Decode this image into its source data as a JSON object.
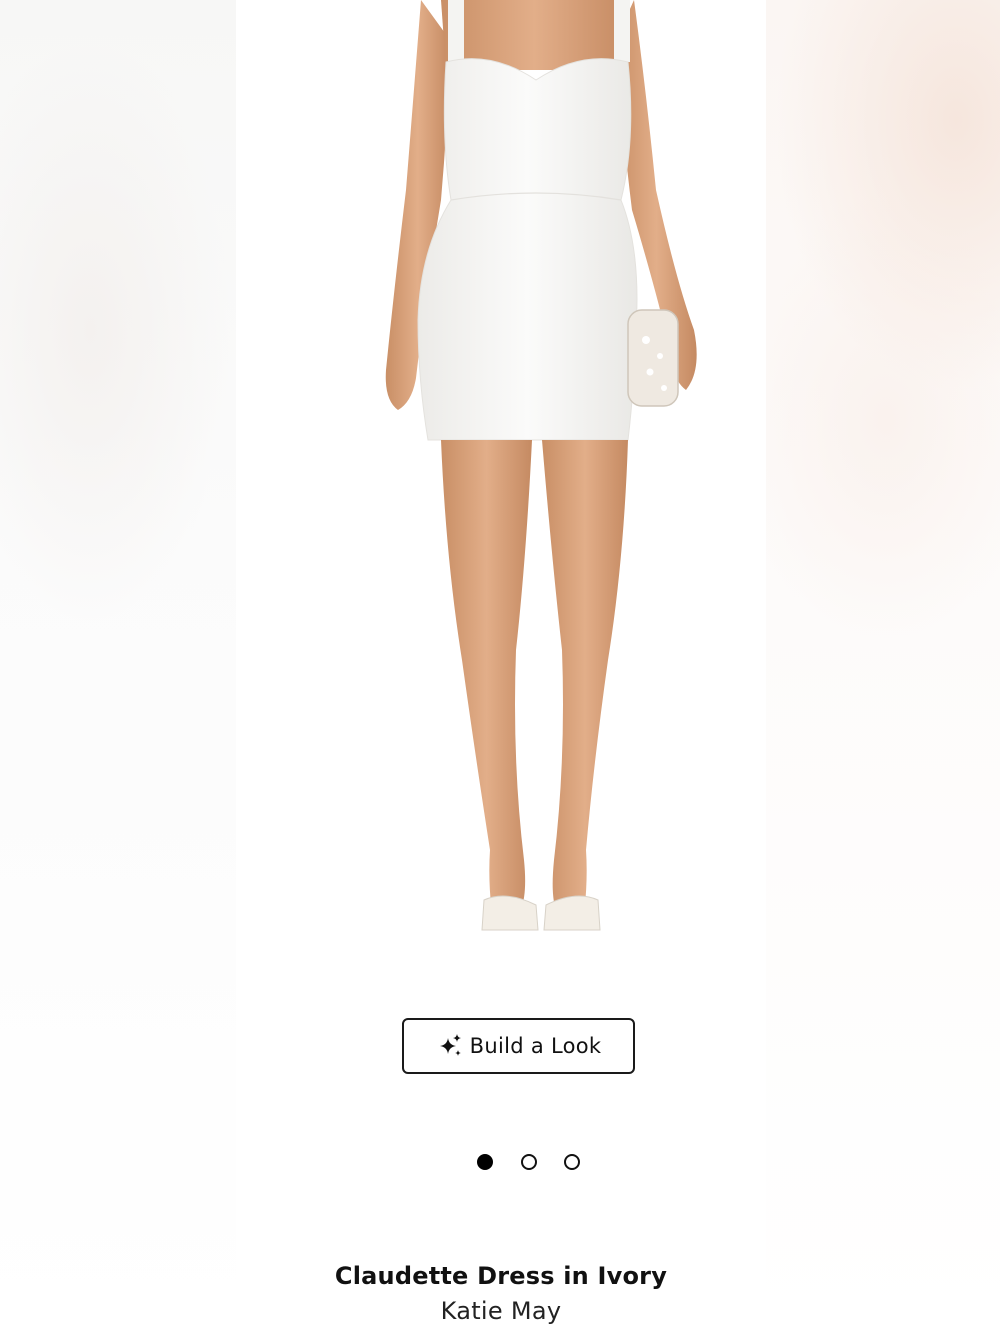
{
  "product": {
    "image_alt": "Claudette Dress in Ivory",
    "title": "Claudette Dress in Ivory",
    "brand": "Katie May"
  },
  "build_look": {
    "label": "Build a Look",
    "icon": "sparkles-icon"
  },
  "carousel": {
    "total": 3,
    "active_index": 0
  },
  "colors": {
    "button_border": "#1a1a1a",
    "dot_active": "#000000",
    "text": "#111111"
  }
}
